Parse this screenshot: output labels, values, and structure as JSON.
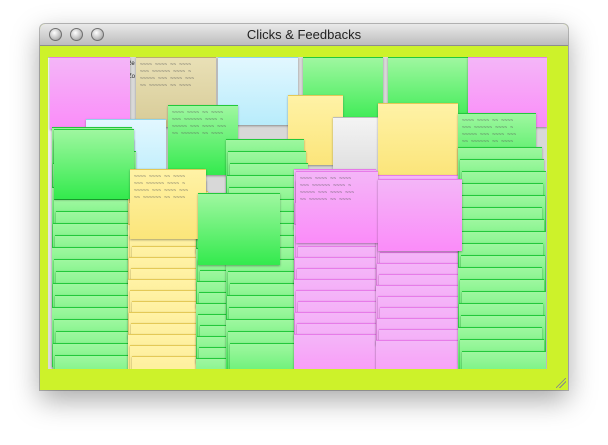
{
  "window": {
    "title": "Clicks & Feedbacks",
    "controls": [
      "close-button",
      "minimize-button",
      "zoom-button"
    ],
    "background_color": "#cdf22a"
  },
  "notes_board": {
    "palette": {
      "pink": "#fb8cf9",
      "green": "#33ea4d",
      "yellow": "#fbe57a",
      "blue": "#b8ecfb",
      "gray": "#d9d9d9",
      "tan": "#d7cb97"
    },
    "visible_label": "2e",
    "visible_label_2": "Zo",
    "scribble_text": "~~~~ ~~~~ ~~ ~~~~\n~~~ ~~~~~~ ~~~~ ~\n~~~~~ ~~~ ~~~~ ~~~\n~~ ~~~~~~ ~~ ~~~~"
  }
}
